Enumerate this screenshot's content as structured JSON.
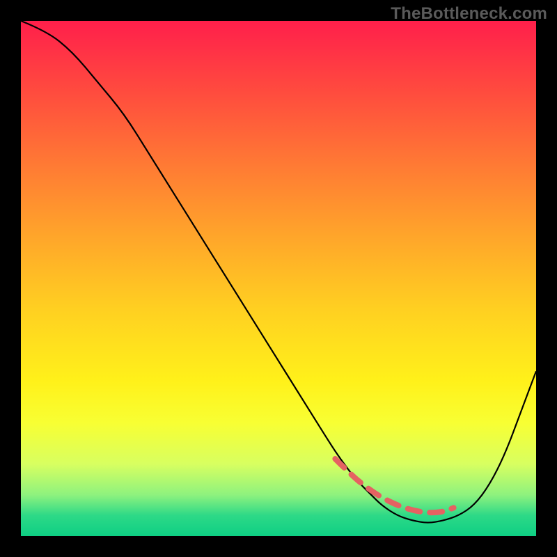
{
  "watermark": "TheBottleneck.com",
  "chart_data": {
    "type": "line",
    "title": "",
    "xlabel": "",
    "ylabel": "",
    "xlim": [
      0,
      100
    ],
    "ylim": [
      0,
      100
    ],
    "background_gradient": {
      "direction": "vertical",
      "stops": [
        {
          "pos": 0,
          "color": "#ff1f4b"
        },
        {
          "pos": 14,
          "color": "#ff4c3e"
        },
        {
          "pos": 28,
          "color": "#ff7a34"
        },
        {
          "pos": 42,
          "color": "#ffa62a"
        },
        {
          "pos": 56,
          "color": "#ffd021"
        },
        {
          "pos": 70,
          "color": "#fff11a"
        },
        {
          "pos": 78,
          "color": "#f8ff33"
        },
        {
          "pos": 86,
          "color": "#d8ff60"
        },
        {
          "pos": 92,
          "color": "#8ef27e"
        },
        {
          "pos": 96,
          "color": "#2dd987"
        },
        {
          "pos": 100,
          "color": "#0ecf84"
        }
      ]
    },
    "series": [
      {
        "name": "bottleneck-curve",
        "x": [
          0,
          5,
          10,
          15,
          20,
          25,
          30,
          35,
          40,
          45,
          50,
          55,
          60,
          62,
          65,
          68,
          70,
          73,
          76,
          79,
          82,
          85,
          88,
          91,
          94,
          97,
          100
        ],
        "y": [
          100,
          98,
          94,
          88,
          82,
          74,
          66,
          58,
          50,
          42,
          34,
          26,
          18,
          15,
          11,
          8,
          6,
          4,
          3,
          2.5,
          3,
          4,
          6,
          10,
          16,
          24,
          32
        ]
      },
      {
        "name": "optimal-range",
        "style": "dashed",
        "color": "#e56262",
        "x": [
          61,
          64,
          67,
          70,
          73,
          76,
          79,
          82,
          84
        ],
        "y": [
          15,
          12,
          9.5,
          7.5,
          6,
          5,
          4.5,
          4.7,
          5.5
        ]
      }
    ]
  }
}
